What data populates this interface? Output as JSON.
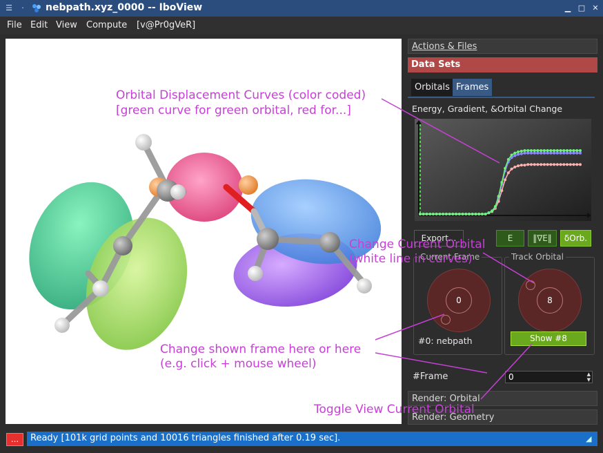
{
  "window": {
    "title": "nebpath.xyz_0000 -- IboView",
    "menu_icon": "hamburger-icon",
    "pin_icon": "pin-icon",
    "app_icon": "atoms-icon",
    "minimize_icon": "minimize-icon",
    "maximize_icon": "maximize-icon",
    "close_icon": "close-icon"
  },
  "menu": {
    "items": [
      "File",
      "Edit",
      "View",
      "Compute",
      "[v@Pr0gVeR]"
    ]
  },
  "panel": {
    "actions_files": "Actions & Files",
    "data_sets": "Data Sets",
    "tabs": [
      "Orbitals",
      "Frames"
    ],
    "plot_title": "Energy, Gradient, &Orbital Change",
    "buttons": {
      "export": "Export...",
      "e": "E",
      "grad": "‖∇E‖",
      "dorb": "δOrb."
    },
    "current_frame": {
      "label": "Current Frame",
      "value": "0",
      "frame_name": "#0: nebpath"
    },
    "track_orbital": {
      "label": "Track Orbital",
      "value": "8",
      "show_button": "Show #8"
    },
    "frame_spin": {
      "label": "#Frame",
      "value": "0"
    },
    "render_orbital": "Render: Orbital",
    "render_geometry": "Render: Geometry"
  },
  "status": {
    "button": "...",
    "text": "Ready [101k grid points and 10016 triangles finished after 0.19 sec]."
  },
  "annotations": {
    "curves_line1": "Orbital Displacement Curves (color coded)",
    "curves_line2": "[green curve for green orbital, red for...]",
    "orbital_line1": "Change Current Orbital",
    "orbital_line2": "(white line in curves)",
    "frame_line1": "Change shown frame here or here",
    "frame_line2": "(e.g. click + mouse wheel)",
    "toggle": "Toggle View Current Orbital"
  },
  "colors": {
    "titlebar": "#2b4d7e",
    "datasets_bar": "#b04848",
    "annotation": "#c640d6",
    "status_blue": "#1a6fc8",
    "green_button": "#6aa81e"
  },
  "chart_data": {
    "type": "line",
    "x": [
      0,
      1,
      2,
      3,
      4,
      5,
      6,
      7,
      8,
      9,
      10,
      11,
      12,
      13,
      14,
      15,
      16,
      17,
      18,
      19,
      20,
      21,
      22,
      23,
      24,
      25,
      26,
      27,
      28,
      29,
      30,
      31,
      32,
      33,
      34,
      35,
      36,
      37,
      38,
      39,
      40,
      41,
      42,
      43,
      44,
      45,
      46,
      47,
      48,
      49
    ],
    "series": [
      {
        "color": "#6ef07a",
        "values": [
          0,
          0,
          0,
          0,
          0,
          0,
          0,
          0,
          0,
          0,
          0,
          0,
          0,
          0,
          0,
          0,
          0,
          0,
          0,
          0,
          0,
          0.02,
          0.05,
          0.12,
          0.28,
          0.5,
          0.72,
          0.86,
          0.93,
          0.96,
          0.98,
          0.99,
          1,
          1,
          1,
          1,
          1,
          1,
          1,
          1,
          1,
          1,
          1,
          1,
          1,
          1,
          1,
          1,
          1,
          1
        ]
      },
      {
        "color": "#8a8aff",
        "values": [
          0,
          0,
          0,
          0,
          0,
          0,
          0,
          0,
          0,
          0,
          0,
          0,
          0,
          0,
          0,
          0,
          0,
          0,
          0,
          0,
          0,
          0.02,
          0.05,
          0.11,
          0.26,
          0.47,
          0.68,
          0.82,
          0.89,
          0.92,
          0.94,
          0.95,
          0.96,
          0.96,
          0.96,
          0.96,
          0.96,
          0.96,
          0.96,
          0.96,
          0.96,
          0.96,
          0.96,
          0.96,
          0.96,
          0.96,
          0.96,
          0.96,
          0.96,
          0.96
        ]
      },
      {
        "color": "#ffb0b0",
        "values": [
          0,
          0,
          0,
          0,
          0,
          0,
          0,
          0,
          0,
          0,
          0,
          0,
          0,
          0,
          0,
          0,
          0,
          0,
          0,
          0,
          0,
          0.02,
          0.04,
          0.09,
          0.2,
          0.37,
          0.54,
          0.65,
          0.71,
          0.74,
          0.76,
          0.77,
          0.77,
          0.78,
          0.78,
          0.78,
          0.78,
          0.78,
          0.78,
          0.78,
          0.78,
          0.78,
          0.78,
          0.78,
          0.78,
          0.78,
          0.78,
          0.78,
          0.78,
          0.78
        ]
      }
    ],
    "current_frame_line": {
      "x": 0,
      "color": "#5fd35f"
    }
  }
}
